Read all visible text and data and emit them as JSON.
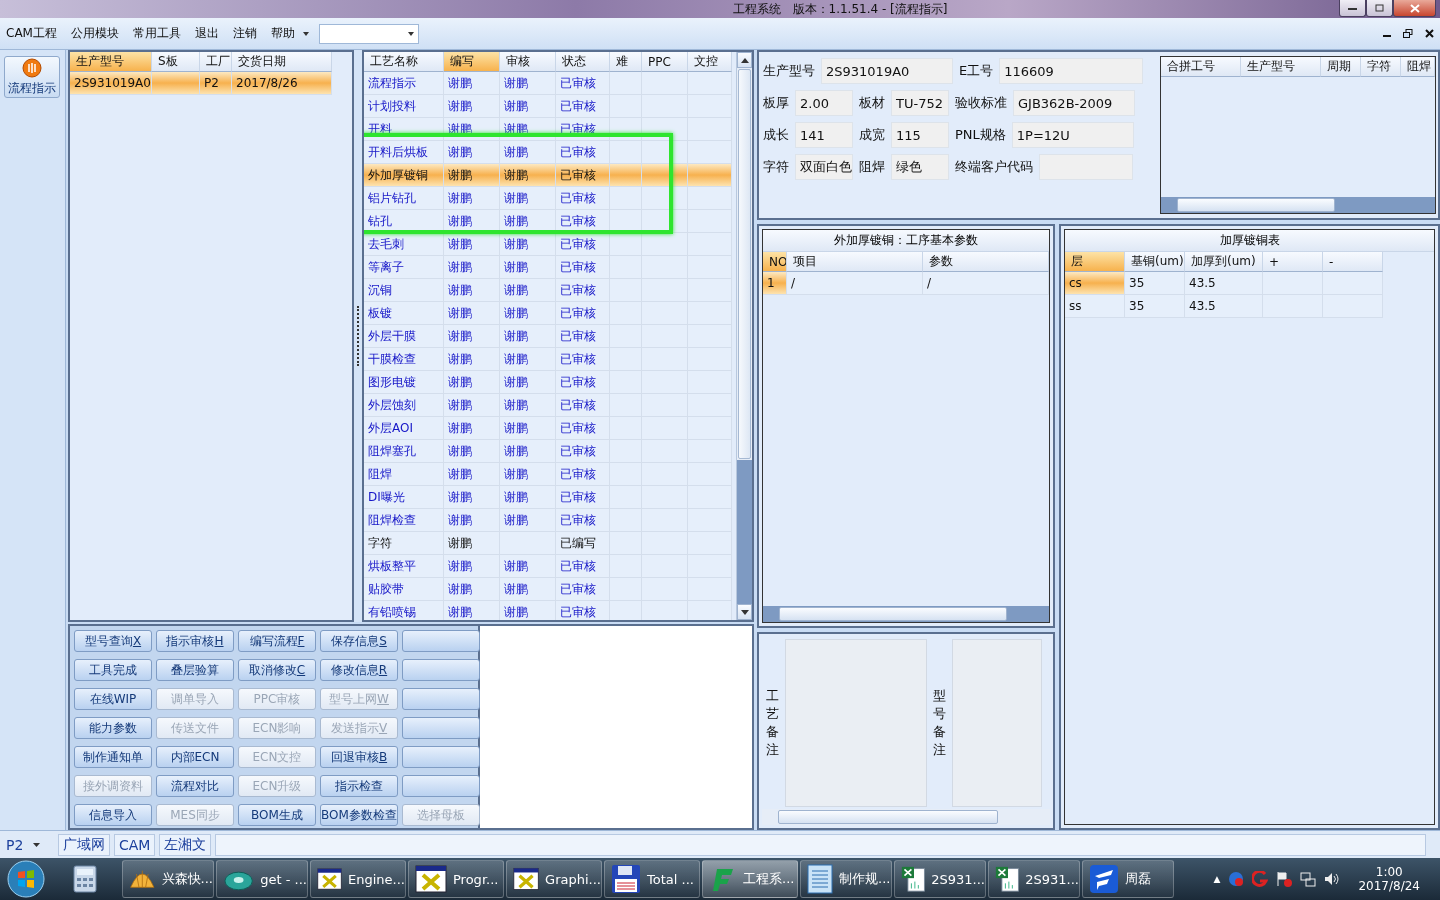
{
  "window": {
    "title": "工程系统　版本：1.1.51.4 - [流程指示]"
  },
  "menu": {
    "items": [
      "CAM工程",
      "公用模块",
      "常用工具",
      "退出",
      "注销",
      "帮助"
    ]
  },
  "sidebar": {
    "items": [
      {
        "label": "流程指示",
        "selected": true
      }
    ]
  },
  "orders": {
    "columns": [
      {
        "label": "生产型号",
        "selected": true
      },
      {
        "label": "S板",
        "selected": false
      },
      {
        "label": "工厂",
        "selected": false
      },
      {
        "label": "交货日期",
        "selected": false
      }
    ],
    "rows": [
      {
        "cells": [
          "2S931019A0",
          "",
          "P2",
          "2017/8/26"
        ],
        "selected": true
      }
    ]
  },
  "process": {
    "columns": [
      {
        "label": "工艺名称",
        "selected": false
      },
      {
        "label": "编写",
        "selected": true
      },
      {
        "label": "审核",
        "selected": false
      },
      {
        "label": "状态",
        "selected": false
      },
      {
        "label": "难",
        "selected": false
      },
      {
        "label": "PPC",
        "selected": false
      },
      {
        "label": "文控",
        "selected": false
      }
    ],
    "rows": [
      {
        "name": "流程指示",
        "writer": "谢鹏",
        "reviewer": "谢鹏",
        "status": "已审核",
        "kind": "reviewed",
        "selected": false
      },
      {
        "name": "计划投料",
        "writer": "谢鹏",
        "reviewer": "谢鹏",
        "status": "已审核",
        "kind": "reviewed",
        "selected": false
      },
      {
        "name": "开料",
        "writer": "谢鹏",
        "reviewer": "谢鹏",
        "status": "已审核",
        "kind": "reviewed",
        "selected": false
      },
      {
        "name": "开料后烘板",
        "writer": "谢鹏",
        "reviewer": "谢鹏",
        "status": "已审核",
        "kind": "reviewed",
        "selected": false
      },
      {
        "name": "外加厚镀铜",
        "writer": "谢鹏",
        "reviewer": "谢鹏",
        "status": "已审核",
        "kind": "reviewed",
        "selected": true
      },
      {
        "name": "铝片钻孔",
        "writer": "谢鹏",
        "reviewer": "谢鹏",
        "status": "已审核",
        "kind": "reviewed",
        "selected": false
      },
      {
        "name": "钻孔",
        "writer": "谢鹏",
        "reviewer": "谢鹏",
        "status": "已审核",
        "kind": "reviewed",
        "selected": false
      },
      {
        "name": "去毛刺",
        "writer": "谢鹏",
        "reviewer": "谢鹏",
        "status": "已审核",
        "kind": "reviewed",
        "selected": false
      },
      {
        "name": "等离子",
        "writer": "谢鹏",
        "reviewer": "谢鹏",
        "status": "已审核",
        "kind": "reviewed",
        "selected": false
      },
      {
        "name": "沉铜",
        "writer": "谢鹏",
        "reviewer": "谢鹏",
        "status": "已审核",
        "kind": "reviewed",
        "selected": false
      },
      {
        "name": "板镀",
        "writer": "谢鹏",
        "reviewer": "谢鹏",
        "status": "已审核",
        "kind": "reviewed",
        "selected": false
      },
      {
        "name": "外层干膜",
        "writer": "谢鹏",
        "reviewer": "谢鹏",
        "status": "已审核",
        "kind": "reviewed",
        "selected": false
      },
      {
        "name": "干膜检查",
        "writer": "谢鹏",
        "reviewer": "谢鹏",
        "status": "已审核",
        "kind": "reviewed",
        "selected": false
      },
      {
        "name": "图形电镀",
        "writer": "谢鹏",
        "reviewer": "谢鹏",
        "status": "已审核",
        "kind": "reviewed",
        "selected": false
      },
      {
        "name": "外层蚀刻",
        "writer": "谢鹏",
        "reviewer": "谢鹏",
        "status": "已审核",
        "kind": "reviewed",
        "selected": false
      },
      {
        "name": "外层AOI",
        "writer": "谢鹏",
        "reviewer": "谢鹏",
        "status": "已审核",
        "kind": "reviewed",
        "selected": false
      },
      {
        "name": "阻焊塞孔",
        "writer": "谢鹏",
        "reviewer": "谢鹏",
        "status": "已审核",
        "kind": "reviewed",
        "selected": false
      },
      {
        "name": "阻焊",
        "writer": "谢鹏",
        "reviewer": "谢鹏",
        "status": "已审核",
        "kind": "reviewed",
        "selected": false
      },
      {
        "name": "DI曝光",
        "writer": "谢鹏",
        "reviewer": "谢鹏",
        "status": "已审核",
        "kind": "reviewed",
        "selected": false
      },
      {
        "name": "阻焊检查",
        "writer": "谢鹏",
        "reviewer": "谢鹏",
        "status": "已审核",
        "kind": "reviewed",
        "selected": false
      },
      {
        "name": "字符",
        "writer": "谢鹏",
        "status": "已编写",
        "kind": "written",
        "selected": false
      },
      {
        "name": "烘板整平",
        "writer": "谢鹏",
        "reviewer": "谢鹏",
        "status": "已审核",
        "kind": "reviewed",
        "selected": false
      },
      {
        "name": "贴胶带",
        "writer": "谢鹏",
        "reviewer": "谢鹏",
        "status": "已审核",
        "kind": "reviewed",
        "selected": false
      },
      {
        "name": "有铅喷锡",
        "writer": "谢鹏",
        "reviewer": "谢鹏",
        "status": "已审核",
        "kind": "reviewed",
        "selected": false
      }
    ]
  },
  "actions": [
    {
      "label": "型号查询",
      "key": "X",
      "disabled": false
    },
    {
      "label": "指示审核",
      "key": "H",
      "disabled": false
    },
    {
      "label": "编写流程",
      "key": "F",
      "disabled": false
    },
    {
      "label": "保存信息",
      "key": "S",
      "disabled": false
    },
    {
      "disabled": false
    },
    {
      "label": "工具完成",
      "disabled": false
    },
    {
      "label": "叠层验算",
      "disabled": false
    },
    {
      "label": "取消修改",
      "key": "C",
      "disabled": false
    },
    {
      "label": "修改信息",
      "key": "R",
      "disabled": false
    },
    {
      "disabled": false
    },
    {
      "label": "在线WIP",
      "disabled": false
    },
    {
      "label": "调单导入",
      "disabled": true
    },
    {
      "label": "PPC审核",
      "disabled": true
    },
    {
      "label": "型号上网",
      "key": "W",
      "disabled": true
    },
    {
      "disabled": false
    },
    {
      "label": "能力参数",
      "disabled": false
    },
    {
      "label": "传送文件",
      "disabled": true
    },
    {
      "label": "ECN影响",
      "disabled": true
    },
    {
      "label": "发送指示",
      "key": "V",
      "disabled": true
    },
    {
      "disabled": false
    },
    {
      "label": "制作通知单",
      "disabled": false
    },
    {
      "label": "内部ECN",
      "disabled": false
    },
    {
      "label": "ECN文控",
      "disabled": true
    },
    {
      "label": "回退审核",
      "key": "B",
      "disabled": false
    },
    {
      "disabled": false
    },
    {
      "label": "接外调资料",
      "disabled": true
    },
    {
      "label": "流程对比",
      "disabled": false
    },
    {
      "label": "ECN升级",
      "disabled": true
    },
    {
      "label": "指示检查",
      "disabled": false
    },
    {
      "disabled": false
    },
    {
      "label": "信息导入",
      "disabled": false
    },
    {
      "label": "MES同步",
      "disabled": true
    },
    {
      "label": "BOM生成",
      "disabled": false
    },
    {
      "label": "BOM参数检查",
      "disabled": false
    },
    {
      "label": "选择母板",
      "disabled": true
    }
  ],
  "info": {
    "lines": [
      {
        "fields": [
          {
            "label": "生产型号",
            "value": "2S931019A0",
            "kind": "wide"
          },
          {
            "label": "E工号",
            "value": "116609",
            "kind": "wide"
          }
        ]
      },
      {
        "fields": [
          {
            "label": "板厚",
            "value": "2.00",
            "kind": "narrow"
          },
          {
            "label": "板材",
            "value": "TU-752",
            "kind": "narrow"
          },
          {
            "label": "验收标准",
            "value": "GJB362B-2009",
            "kind": "wide"
          }
        ]
      },
      {
        "fields": [
          {
            "label": "成长",
            "value": "141",
            "kind": "narrow"
          },
          {
            "label": "成宽",
            "value": "115",
            "kind": "narrow"
          },
          {
            "label": "PNL规格",
            "value": "1P=12U",
            "kind": "wide"
          }
        ]
      },
      {
        "fields": [
          {
            "label": "字符",
            "value": "双面白色",
            "kind": "narrow"
          },
          {
            "label": "阻焊",
            "value": "绿色",
            "kind": "narrow"
          },
          {
            "label": "终端客户代码",
            "kind": "wide"
          }
        ]
      }
    ]
  },
  "merge_table": {
    "columns": [
      "合拼工号",
      "生产型号",
      "周期",
      "字符",
      "阻焊"
    ]
  },
  "step_params": {
    "title": "外加厚镀铜：工序基本参数",
    "columns": [
      "NO",
      "项目",
      "参数"
    ],
    "rows": [
      {
        "cells": [
          "1",
          "/",
          "/"
        ],
        "selected": true
      }
    ]
  },
  "plating": {
    "title": "加厚镀铜表",
    "columns": [
      "层",
      "基铜(um)",
      "加厚到(um)",
      "+",
      "-"
    ],
    "rows": [
      {
        "cells": [
          "cs",
          "35",
          "43.5",
          "",
          ""
        ],
        "selected": true
      },
      {
        "cells": [
          "ss",
          "35",
          "43.5",
          "",
          ""
        ],
        "selected": false
      }
    ]
  },
  "remarks": [
    {
      "label": "工艺备注"
    },
    {
      "label": "型号备注"
    }
  ],
  "status_bar": {
    "factory": "P2",
    "tabs": [
      "广域网",
      "CAM",
      "左湘文"
    ]
  },
  "taskbar": {
    "items": [
      {
        "kind": "calculator"
      },
      {
        "kind": "shell",
        "label": "兴森快...",
        "selected": false
      },
      {
        "kind": "disc",
        "label": "get - ...",
        "selected": false
      },
      {
        "kind": "window",
        "label": "Engine...",
        "selected": false
      },
      {
        "kind": "window",
        "label": "Progr...",
        "selected": false
      },
      {
        "kind": "window",
        "label": "Graphi...",
        "selected": false
      },
      {
        "kind": "floppy",
        "label": "Total ...",
        "selected": false
      },
      {
        "kind": "pf",
        "label": "工程系...",
        "selected": true
      },
      {
        "kind": "doc",
        "label": "制作规...",
        "selected": false
      },
      {
        "kind": "sheet",
        "label": "2S931...",
        "selected": false
      },
      {
        "kind": "sheet",
        "label": "2S931...",
        "selected": false
      },
      {
        "kind": "flogo",
        "label": "周磊",
        "selected": false
      }
    ],
    "tray_arrow": "▲",
    "time": "1:00",
    "date": "2017/8/24"
  }
}
